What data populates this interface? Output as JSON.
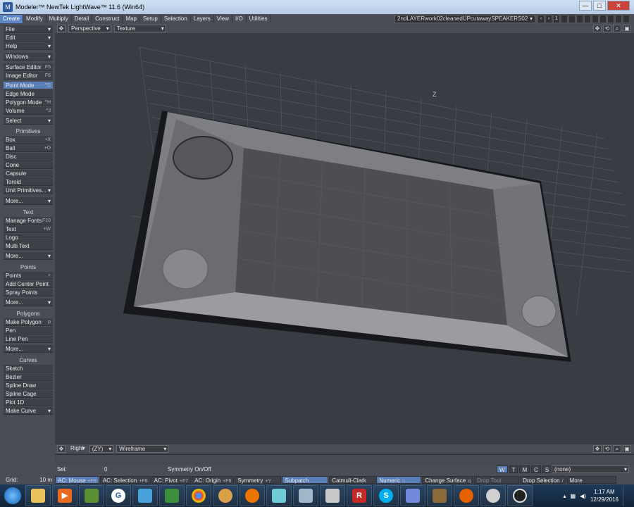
{
  "window": {
    "title": "Modeler™ NewTek LightWave™ 11.6 (Win64)",
    "buttons": [
      "—",
      "□",
      "✕"
    ]
  },
  "menubar": {
    "tabs": [
      "Create",
      "Modify",
      "Multiply",
      "Detail",
      "Construct",
      "Map",
      "Setup",
      "Selection",
      "Layers",
      "View",
      "I/O",
      "Utilities"
    ],
    "active_tab": "Create",
    "object_name": "2ndLAYERwork02cleanedUPcutawaySPEAKERS02",
    "layer_num": "1"
  },
  "sidebar": {
    "file": "File",
    "edit": "Edit",
    "help": "Help",
    "windows": "Windows",
    "surface_editor": "Surface Editor",
    "surface_editor_key": "F5",
    "image_editor": "Image Editor",
    "image_editor_key": "F6",
    "point_mode": "Point Mode",
    "point_mode_key": "^G",
    "edge_mode": "Edge Mode",
    "polygon_mode": "Polygon Mode",
    "polygon_mode_key": "^H",
    "volume": "Volume",
    "volume_key": "^J",
    "select": "Select",
    "primitives_header": "Primitives",
    "box": "Box",
    "box_key": "+X",
    "ball": "Ball",
    "ball_key": "+O",
    "disc": "Disc",
    "cone": "Cone",
    "capsule": "Capsule",
    "toroid": "Toroid",
    "unit_primitives": "Unit Primitives...",
    "more1": "More...",
    "text_header": "Text",
    "manage_fonts": "Manage Fonts",
    "manage_fonts_key": "F10",
    "text": "Text",
    "text_key": "+W",
    "logo": "Logo",
    "multi_text": "Multi Text",
    "more2": "More...",
    "points_header": "Points",
    "points": "Points",
    "points_key": "+",
    "add_center_point": "Add Center Point",
    "spray_points": "Spray Points",
    "more3": "More...",
    "polygons_header": "Polygons",
    "make_polygon": "Make Polygon",
    "make_polygon_key": "p",
    "pen": "Pen",
    "line_pen": "Line Pen",
    "more4": "More...",
    "curves_header": "Curves",
    "sketch": "Sketch",
    "bezier": "Bezier",
    "spline_draw": "Spline Draw",
    "spline_cage": "Spline Cage",
    "plot_1d": "Plot 1D",
    "make_curve": "Make Curve"
  },
  "viewport_top": {
    "view": "Perspective",
    "shading": "Texture",
    "axis_label": "Z"
  },
  "viewport_bottom": {
    "view": "Right",
    "axes": "(ZY)",
    "shading": "Wireframe"
  },
  "status": {
    "sel_label": "Sel:",
    "sel_value": "0",
    "symmetry_hint": "Symmetry On/Off",
    "wtmcs": [
      "W",
      "T",
      "M",
      "C",
      "S"
    ],
    "none_dd": "(none)",
    "grid_label": "Grid:",
    "grid_value": "10 m",
    "buttons": [
      {
        "label": "AC: Mouse",
        "key": "+F8"
      },
      {
        "label": "AC: Selection",
        "key": "+F8"
      },
      {
        "label": "AC: Pivot",
        "key": "+F7"
      },
      {
        "label": "AC: Origin",
        "key": "+F6"
      },
      {
        "label": "Symmetry",
        "key": "+Y"
      },
      {
        "label": "Subpatch",
        "key": ""
      },
      {
        "label": "Catmull-Clark",
        "key": ""
      },
      {
        "label": "Numeric",
        "key": "n"
      },
      {
        "label": "Change Surface",
        "key": "q"
      },
      {
        "label": "Drop Tool",
        "key": ""
      },
      {
        "label": "Drop Selection",
        "key": "/"
      },
      {
        "label": "More",
        "key": ""
      }
    ]
  },
  "taskbar": {
    "icons": [
      "folder-icon",
      "media-player-icon",
      "minecraft-icon",
      "g-app-icon",
      "box-app-icon",
      "screen-app-icon",
      "chrome-icon",
      "paint-icon",
      "blender-icon",
      "notes-icon",
      "cube-app-icon",
      "calculator-icon",
      "r-app-icon",
      "skype-icon",
      "discord-icon",
      "crate-app-icon",
      "firefox-icon",
      "lightwave-icon",
      "obs-icon"
    ],
    "time": "1:17 AM",
    "date": "12/29/2016"
  }
}
